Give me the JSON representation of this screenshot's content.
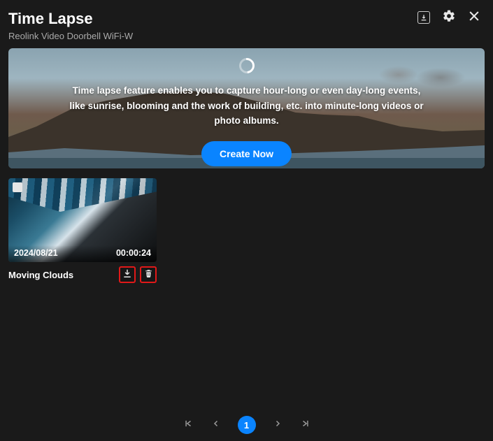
{
  "header": {
    "title": "Time Lapse",
    "subtitle": "Reolink Video Doorbell WiFi-W"
  },
  "banner": {
    "description": "Time lapse feature enables you to capture hour-long or even day-long events, like sunrise, blooming and the work of building, etc. into minute-long videos or photo albums.",
    "create_label": "Create Now"
  },
  "items": [
    {
      "date": "2024/08/21",
      "duration": "00:00:24",
      "title": "Moving Clouds"
    }
  ],
  "pagination": {
    "current": "1"
  },
  "icons": {
    "download": "download-icon",
    "settings": "gear-icon",
    "close": "close-icon",
    "trash": "trash-icon",
    "first": "first-page-icon",
    "prev": "chevron-left-icon",
    "next": "chevron-right-icon",
    "last": "last-page-icon",
    "loader": "spinner-icon"
  }
}
